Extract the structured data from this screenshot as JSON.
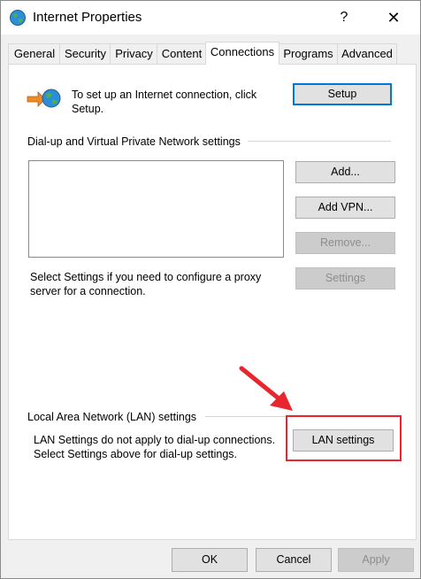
{
  "window": {
    "title": "Internet Properties",
    "help_glyph": "?",
    "close_glyph": "✕"
  },
  "tabs": [
    {
      "label": "General"
    },
    {
      "label": "Security"
    },
    {
      "label": "Privacy"
    },
    {
      "label": "Content"
    },
    {
      "label": "Connections",
      "active": true
    },
    {
      "label": "Programs"
    },
    {
      "label": "Advanced"
    }
  ],
  "setup_section": {
    "text": "To set up an Internet connection, click Setup.",
    "button": "Setup"
  },
  "vpn_section": {
    "heading": "Dial-up and Virtual Private Network settings",
    "add_button": "Add...",
    "add_vpn_button": "Add VPN...",
    "remove_button": "Remove...",
    "settings_button": "Settings",
    "proxy_text": "Select Settings if you need to configure a proxy server for a connection."
  },
  "lan_section": {
    "heading": "Local Area Network (LAN) settings",
    "text": "LAN Settings do not apply to dial-up connections. Select Settings above for dial-up settings.",
    "button": "LAN settings"
  },
  "footer": {
    "ok": "OK",
    "cancel": "Cancel",
    "apply": "Apply"
  },
  "colors": {
    "highlight": "#e8262e",
    "accent": "#0078d7"
  }
}
